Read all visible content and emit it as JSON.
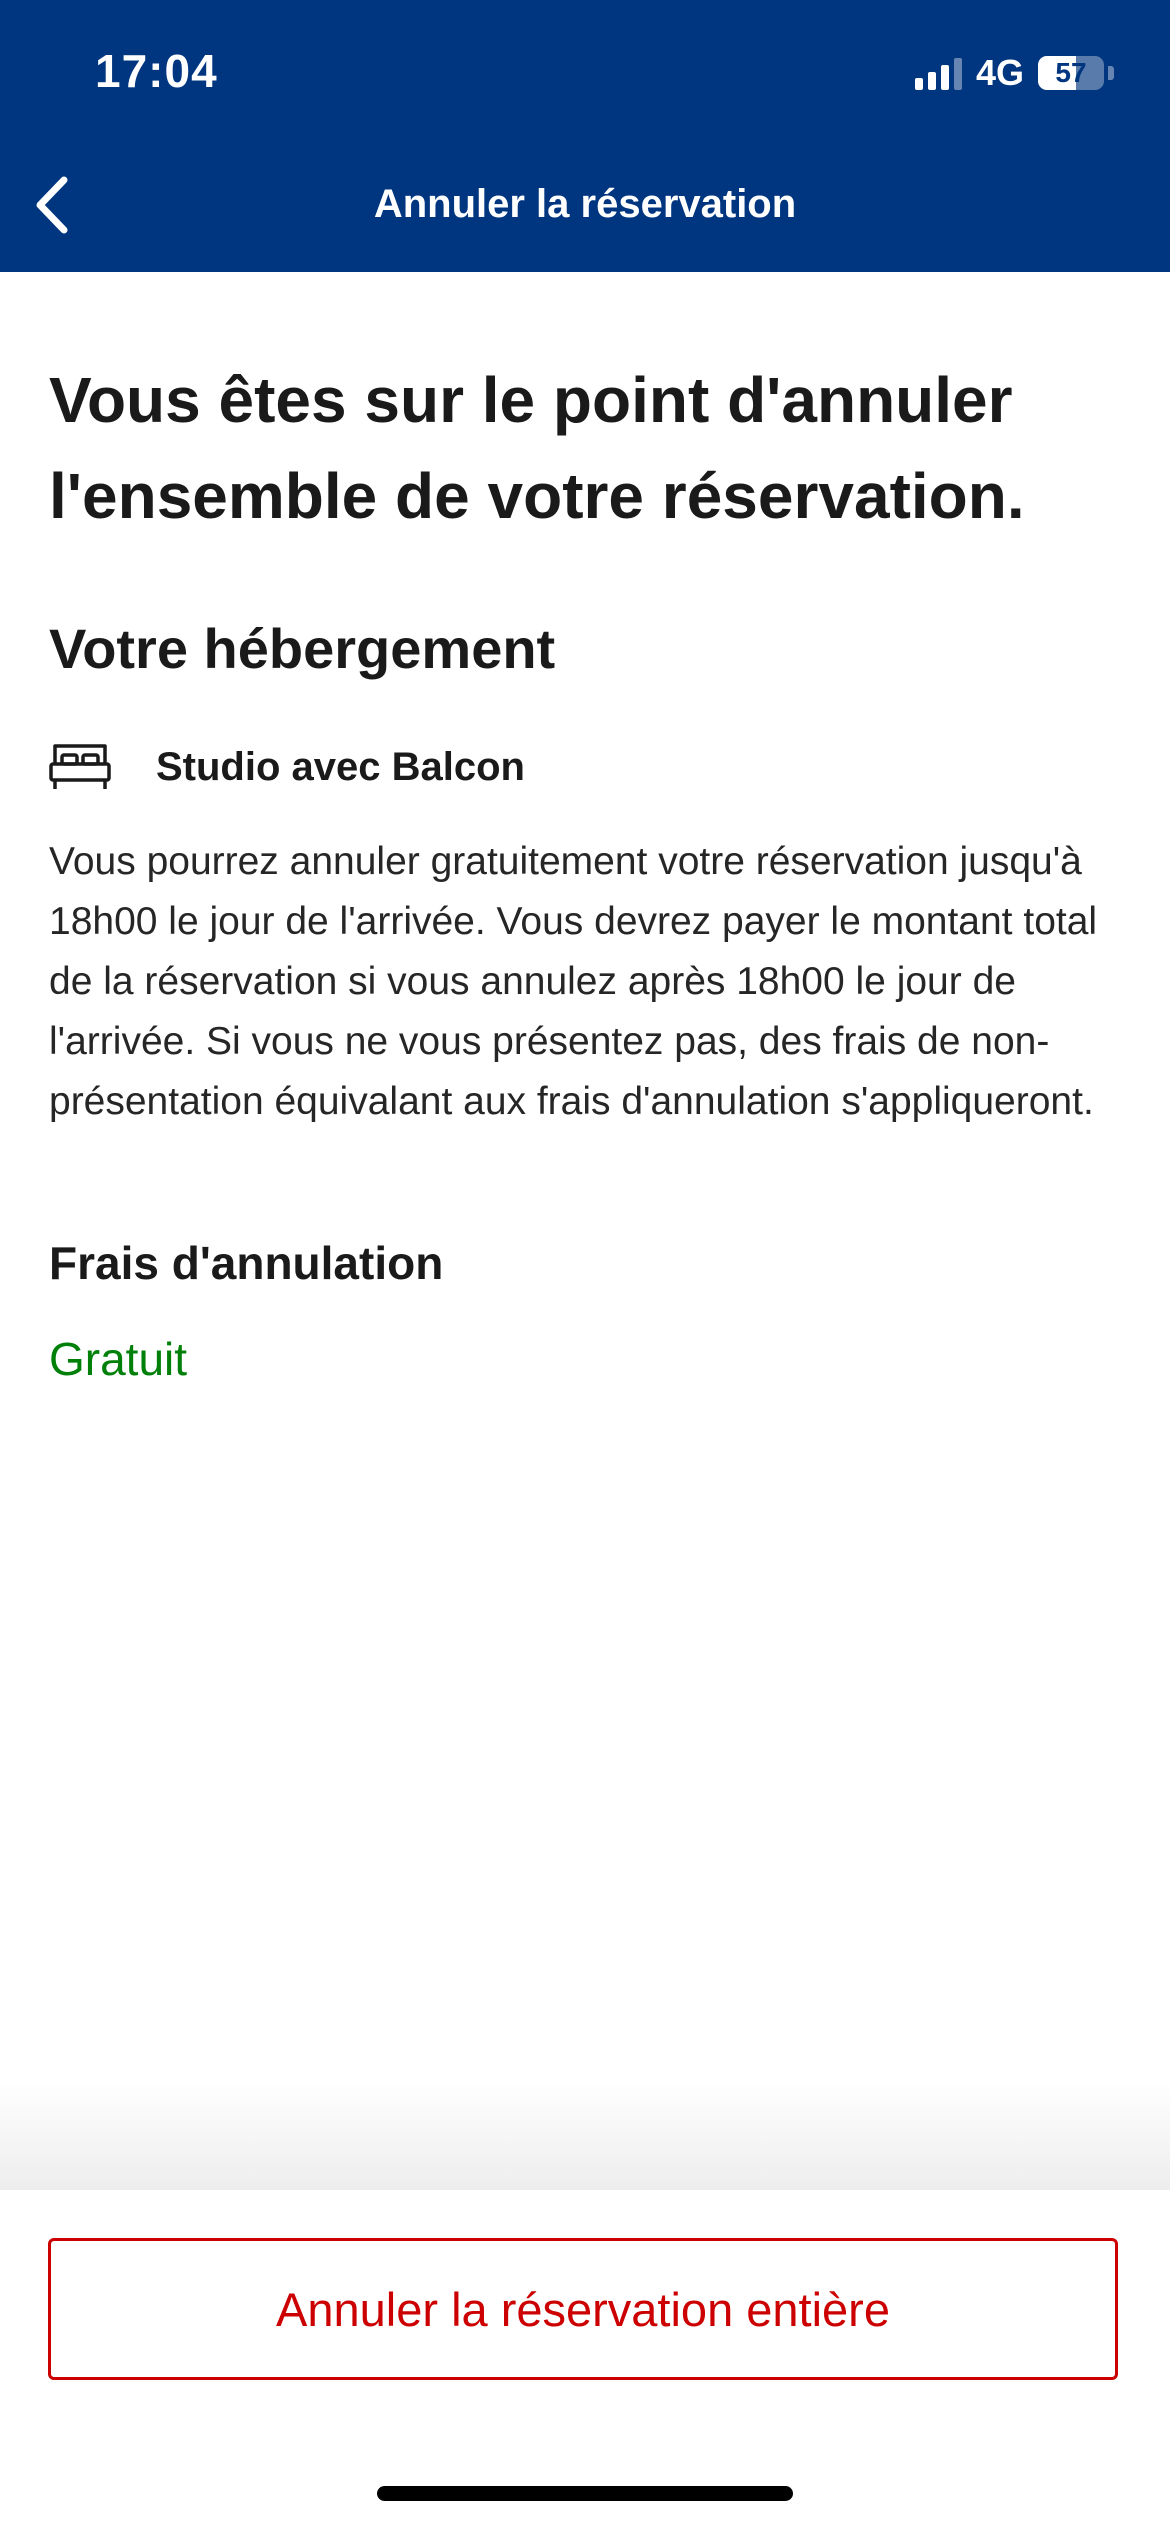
{
  "status_bar": {
    "time": "17:04",
    "network": "4G",
    "battery_level": "57"
  },
  "nav": {
    "title": "Annuler la réservation"
  },
  "main": {
    "headline": "Vous êtes sur le point d'annuler l'ensemble de votre réservation.",
    "section_title": "Votre hébergement",
    "room_name": "Studio avec Balcon",
    "policy_text": "Vous pourrez annuler gratuitement votre réservation jusqu'à 18h00 le jour de l'arrivée. Vous devrez payer le montant total de la réservation si vous annulez après 18h00 le jour de l'arrivée. Si vous ne vous présentez pas, des frais de non-présentation équivalant aux frais d'annulation s'appliqueront.",
    "fees_title": "Frais d'annulation",
    "fees_value": "Gratuit"
  },
  "footer": {
    "cancel_button_label": "Annuler la réservation entière"
  },
  "colors": {
    "header_bg": "#003580",
    "free_green": "#008009",
    "danger_red": "#cc0000"
  },
  "icons": {
    "back": "chevron-left-icon",
    "room": "bed-icon"
  }
}
